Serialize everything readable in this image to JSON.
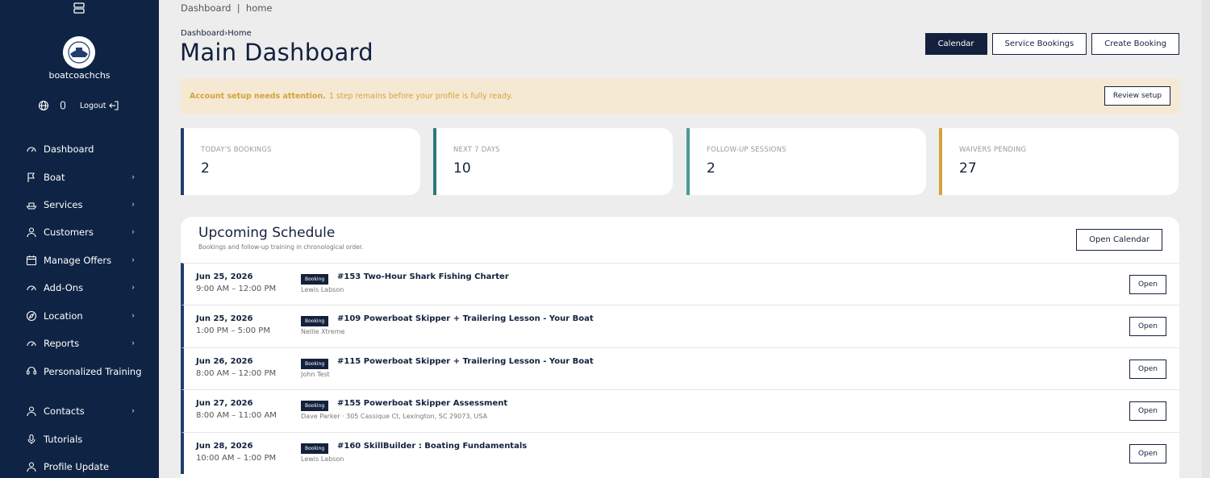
{
  "sidebar": {
    "top_icon": "server-icon",
    "username": "boatcoachchs",
    "utils": {
      "globe_icon": "globe-icon",
      "user_icon": "user-icon",
      "logout_label": "Logout",
      "logout_icon": "logout-icon"
    },
    "items": [
      {
        "label": "Dashboard",
        "icon": "dashboard-icon",
        "has_chevron": false
      },
      {
        "label": "Boat",
        "icon": "flag-icon",
        "has_chevron": true
      },
      {
        "label": "Services",
        "icon": "boat-icon",
        "has_chevron": true
      },
      {
        "label": "Customers",
        "icon": "user-icon",
        "has_chevron": true
      },
      {
        "label": "Manage Offers",
        "icon": "calendar-icon",
        "has_chevron": true
      },
      {
        "label": "Add-Ons",
        "icon": "dashboard-icon",
        "has_chevron": true
      },
      {
        "label": "Location",
        "icon": "compass-icon",
        "has_chevron": true
      },
      {
        "label": "Reports",
        "icon": "dashboard-icon",
        "has_chevron": true
      },
      {
        "label": "Personalized Training",
        "icon": "training-icon",
        "has_chevron": false
      },
      {
        "label": "Contacts",
        "icon": "user-icon",
        "has_chevron": true
      },
      {
        "label": "Tutorials",
        "icon": "mic-icon",
        "has_chevron": false
      },
      {
        "label": "Profile Update",
        "icon": "user-icon",
        "has_chevron": false
      }
    ]
  },
  "main": {
    "topbar": {
      "part1": "Dashboard",
      "separator": "|",
      "part2": "home"
    },
    "breadcrumb": {
      "parent": "Dashboard",
      "sep": "›",
      "current": "Home"
    },
    "title": "Main Dashboard",
    "actions": {
      "calendar": "Calendar",
      "service_bookings": "Service Bookings",
      "create_booking": "Create Booking"
    },
    "alert": {
      "bold": "Account setup needs attention.",
      "text": "1 step remains before your profile is fully ready.",
      "button": "Review setup"
    },
    "stats": [
      {
        "label": "TODAY'S BOOKINGS",
        "value": "2",
        "color": "#1f3e6b"
      },
      {
        "label": "NEXT 7 DAYS",
        "value": "10",
        "color": "#2b7a78"
      },
      {
        "label": "FOLLOW-UP SESSIONS",
        "value": "2",
        "color": "#4a9a98"
      },
      {
        "label": "WAIVERS PENDING",
        "value": "27",
        "color": "#d4a33a"
      }
    ],
    "schedule": {
      "title": "Upcoming Schedule",
      "subtitle": "Bookings and follow-up training in chronological order.",
      "button": "Open Calendar",
      "rows": [
        {
          "date": "Jun 25, 2026",
          "time": "9:00 AM – 12:00 PM",
          "badge": "Booking",
          "title": "#153 Two-Hour Shark Fishing Charter",
          "sub": "Lewis Labson",
          "button": "Open"
        },
        {
          "date": "Jun 25, 2026",
          "time": "1:00 PM – 5:00 PM",
          "badge": "Booking",
          "title": "#109 Powerboat Skipper + Trailering Lesson - Your Boat",
          "sub": "Nellie Xtreme",
          "button": "Open"
        },
        {
          "date": "Jun 26, 2026",
          "time": "8:00 AM – 12:00 PM",
          "badge": "Booking",
          "title": "#115 Powerboat Skipper + Trailering Lesson - Your Boat",
          "sub": "John Test",
          "button": "Open"
        },
        {
          "date": "Jun 27, 2026",
          "time": "8:00 AM – 11:00 AM",
          "badge": "Booking",
          "title": "#155 Powerboat Skipper Assessment",
          "sub": "Dave Parker · 305 Cassique Ct, Lexington, SC 29073, USA",
          "button": "Open"
        },
        {
          "date": "Jun 28, 2026",
          "time": "10:00 AM – 1:00 PM",
          "badge": "Booking",
          "title": "#160 SkillBuilder : Boating Fundamentals",
          "sub": "Lewis Labson",
          "button": "Open"
        }
      ]
    }
  },
  "colors": {
    "sidebar_bg": "#0f2444",
    "primary": "#14213d",
    "alert_bg": "#f5e9d3",
    "alert_text": "#d4a33a"
  }
}
